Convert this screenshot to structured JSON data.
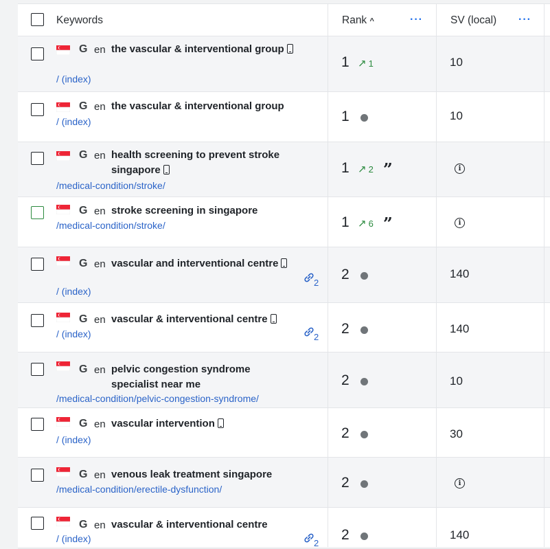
{
  "header": {
    "keywords_label": "Keywords",
    "rank_label": "Rank",
    "rank_sort_icon": "^",
    "sv_label": "SV (local)",
    "more_icon": "···"
  },
  "rows": [
    {
      "lang": "en",
      "keyword": "the vascular & interventional group",
      "mobile": true,
      "url": "/ (index)",
      "rank": "1",
      "change": "1",
      "change_dir": "up",
      "sv": "10"
    },
    {
      "lang": "en",
      "keyword": "the vascular & interventional group",
      "mobile": false,
      "url": "/ (index)",
      "rank": "1",
      "change": "",
      "sv": "10"
    },
    {
      "lang": "en",
      "keyword": "health screening to prevent stroke singapore",
      "mobile": true,
      "url": "/medical-condition/stroke/",
      "rank": "1",
      "change": "2",
      "change_dir": "up",
      "quote": true,
      "sv": ""
    },
    {
      "lang": "en",
      "keyword": "stroke screening in singapore",
      "mobile": false,
      "url": "/medical-condition/stroke/",
      "rank": "1",
      "change": "6",
      "change_dir": "up",
      "quote": true,
      "sv": ""
    },
    {
      "lang": "en",
      "keyword": "vascular and interventional centre",
      "mobile": true,
      "url": "/ (index)",
      "rank": "2",
      "change": "",
      "sv": "140",
      "links": "2"
    },
    {
      "lang": "en",
      "keyword": "vascular & interventional centre",
      "mobile": true,
      "url": "/ (index)",
      "rank": "2",
      "change": "",
      "sv": "140",
      "links": "2"
    },
    {
      "lang": "en",
      "keyword": "pelvic congestion syndrome specialist near me",
      "mobile": false,
      "url": "/medical-condition/pelvic-congestion-syndrome/",
      "rank": "2",
      "change": "",
      "sv": "10"
    },
    {
      "lang": "en",
      "keyword": "vascular intervention",
      "mobile": true,
      "url": "/ (index)",
      "rank": "2",
      "change": "",
      "sv": "30"
    },
    {
      "lang": "en",
      "keyword": "venous leak treatment singapore",
      "mobile": false,
      "url": "/medical-condition/erectile-dysfunction/",
      "rank": "2",
      "change": "",
      "sv": ""
    },
    {
      "lang": "en",
      "keyword": "vascular & interventional centre",
      "mobile": false,
      "url": "/ (index)",
      "rank": "2",
      "change": "",
      "sv": "140",
      "links": "2"
    }
  ],
  "icons": {
    "flag": "singapore-flag-icon",
    "engine": "G",
    "mobile": "mobile-device-icon",
    "link": "link-icon",
    "up": "↗",
    "info": "i",
    "quote": "99"
  },
  "colors": {
    "accent": "#1f6feb",
    "positive": "#2b8a3e",
    "url": "#2a63c8",
    "flag_red": "#ee2536"
  }
}
